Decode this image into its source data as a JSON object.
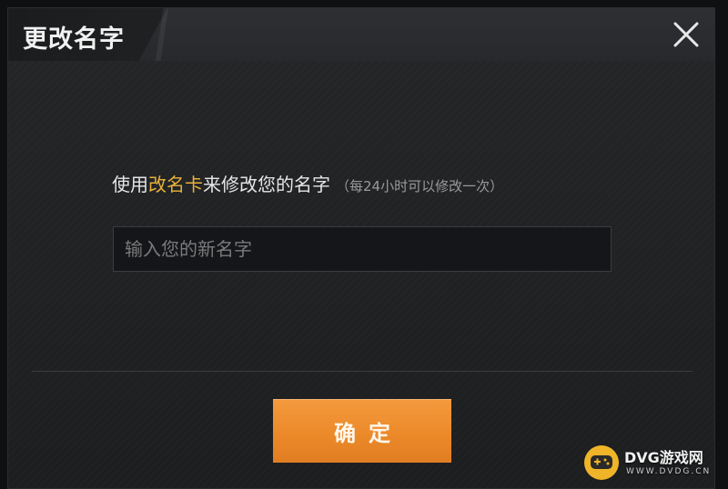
{
  "dialog": {
    "title": "更改名字",
    "close_icon": "close-icon"
  },
  "prompt": {
    "prefix": "使用",
    "item_name": "改名卡",
    "suffix": "来修改您的名字",
    "note": "（每24小时可以修改一次）",
    "highlight_color": "#e8b23a"
  },
  "name_input": {
    "placeholder": "输入您的新名字",
    "value": ""
  },
  "confirm_button": {
    "label": "确定",
    "color": "#ec8a2a"
  },
  "watermark": {
    "logo_icon": "gamepad-icon",
    "name": "DVG游戏网",
    "site": "WWW.DVDG.CN"
  }
}
